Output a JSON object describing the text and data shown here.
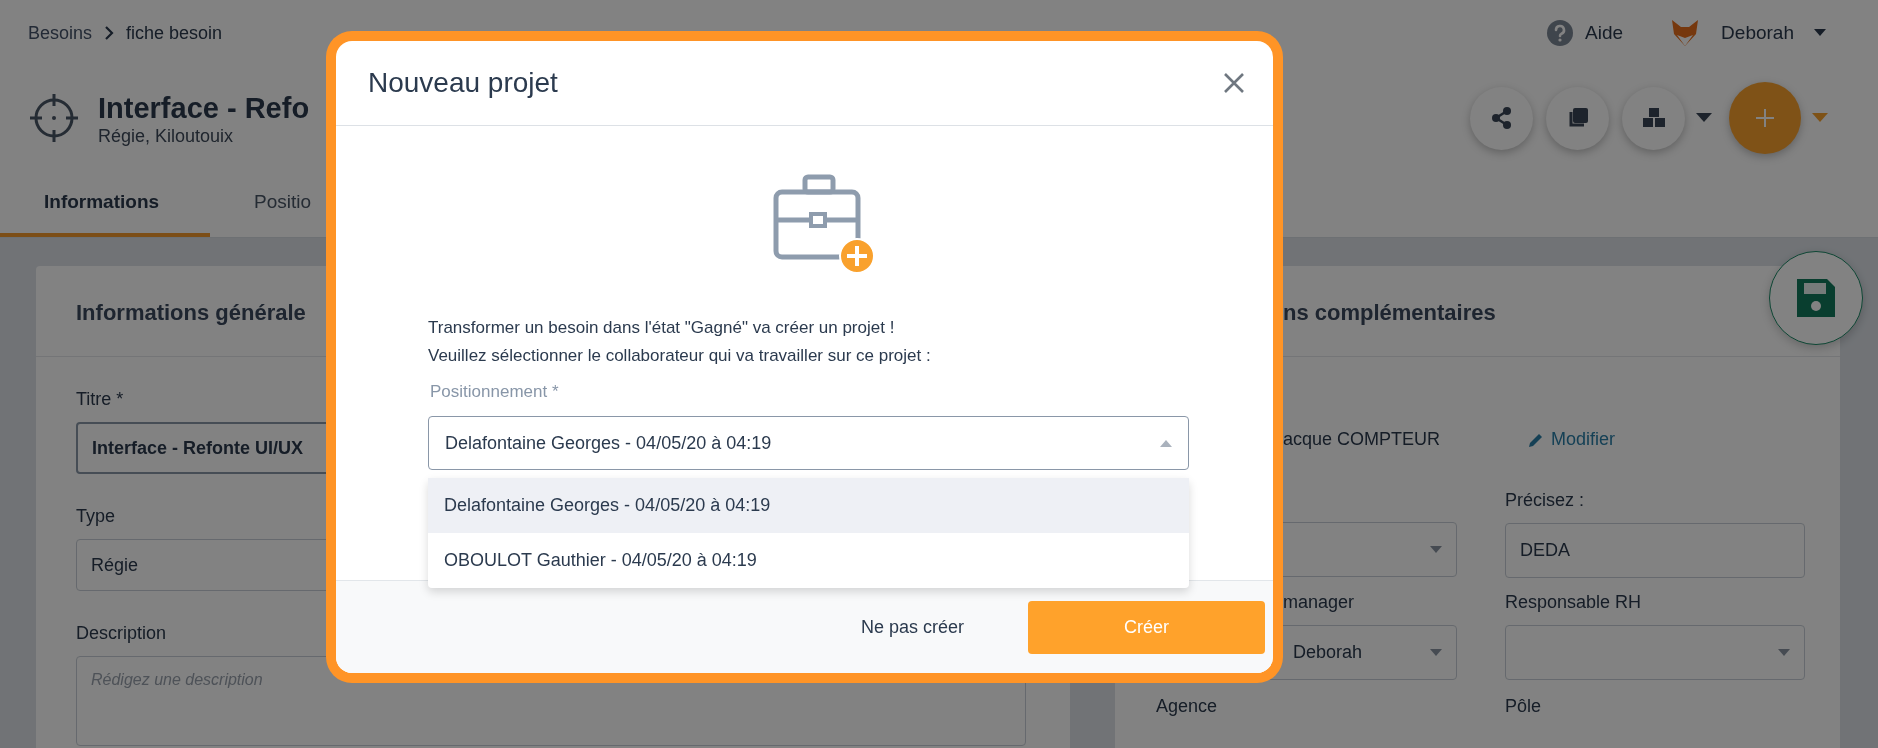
{
  "breadcrumb": [
    {
      "label": "Besoins",
      "kind": "link"
    },
    {
      "label": "fiche besoin",
      "kind": "current"
    }
  ],
  "topbar": {
    "help": "Aide",
    "user": "Deborah"
  },
  "record": {
    "title": "Interface - Refo",
    "subtitle": "Régie, Kiloutouix"
  },
  "actions": [
    {
      "kind": "share",
      "menu": false
    },
    {
      "kind": "copy",
      "menu": false
    },
    {
      "kind": "cubes",
      "menu": true
    },
    {
      "kind": "add",
      "menu": true
    }
  ],
  "tabs": [
    {
      "label": "Informations",
      "selected": true
    },
    {
      "label": "Positio",
      "selected": false
    }
  ],
  "general_card": {
    "heading": "Informations générale",
    "fields": [
      {
        "label": "Titre *",
        "kind": "input",
        "value": "Interface - Refonte UI/UX"
      },
      {
        "label": "Type",
        "kind": "select",
        "value": "Régie"
      },
      {
        "label": "Description",
        "kind": "textarea",
        "placeholder": "Rédigez une description"
      }
    ]
  },
  "extra_card": {
    "heading": "ns complémentaires",
    "contact": "acque COMPTEUR",
    "edit_link": "Modifier",
    "fields": [
      {
        "kind": "select"
      },
      {
        "label": "Précisez :",
        "kind": "input",
        "value": "DEDA"
      },
      {
        "label": "manager",
        "kind": "select",
        "value": "Deborah"
      },
      {
        "label": "Responsable RH",
        "kind": "select"
      },
      {
        "label": "Agence",
        "kind": "label"
      },
      {
        "label": "Pôle",
        "kind": "label"
      }
    ]
  },
  "modal": {
    "title": "Nouveau projet",
    "message": [
      "Transformer un besoin dans l'état \"Gagné\" va créer un projet !",
      "Veuillez sélectionner le collaborateur qui va travailler sur ce projet :"
    ],
    "field_label": "Positionnement *",
    "value": "Delafontaine Georges - 04/05/20 à 04:19",
    "expanded": true,
    "options": [
      {
        "label": "Delafontaine Georges - 04/05/20 à 04:19",
        "selected": true
      },
      {
        "label": "OBOULOT Gauthier - 04/05/20 à 04:19",
        "selected": false
      }
    ],
    "buttons": [
      {
        "label": "Ne pas créer",
        "kind": "secondary"
      },
      {
        "label": "Créer",
        "kind": "primary"
      }
    ]
  }
}
